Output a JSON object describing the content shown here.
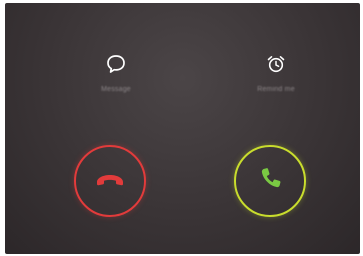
{
  "actions": {
    "message": {
      "label": "Message",
      "icon": "message-bubble-icon"
    },
    "remind": {
      "label": "Remind me",
      "icon": "alarm-clock-icon"
    }
  },
  "call_controls": {
    "decline": {
      "icon": "phone-hangup-icon",
      "color": "#e23b3b"
    },
    "answer": {
      "icon": "phone-answer-icon",
      "color": "#c9dd2d"
    }
  }
}
